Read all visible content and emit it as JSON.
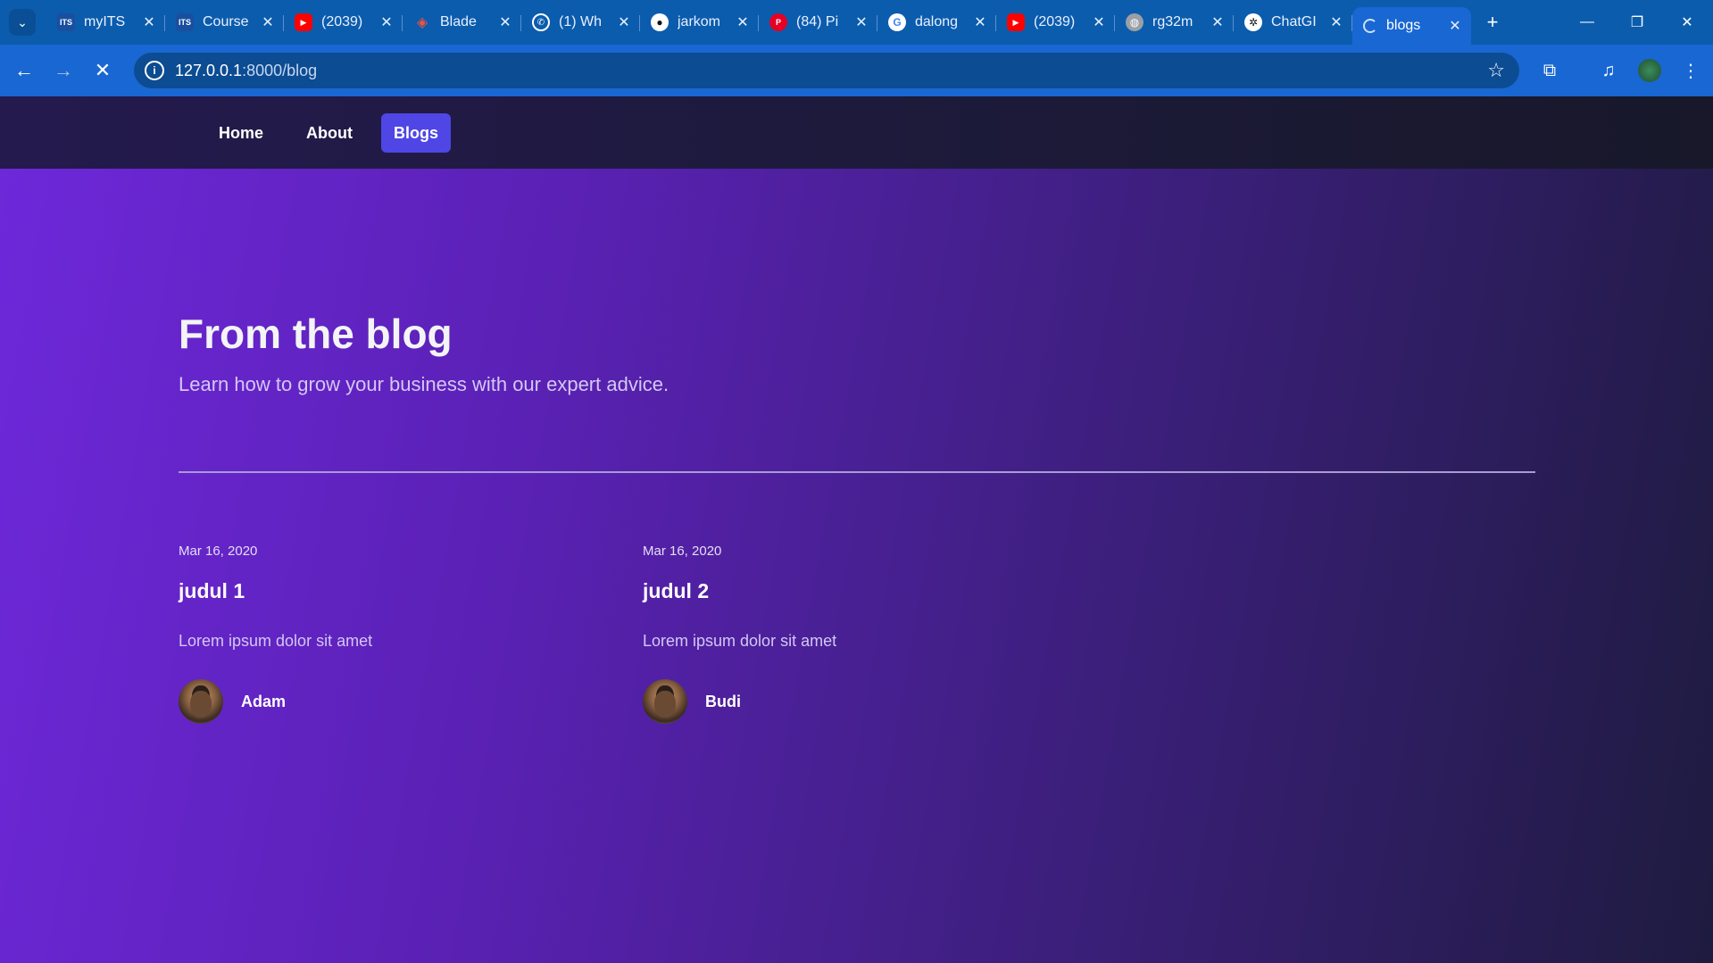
{
  "browser": {
    "tabs": [
      {
        "title": "myITS",
        "favicon": "its-logo",
        "color": "#1a4fa0"
      },
      {
        "title": "Course",
        "favicon": "its-logo",
        "color": "#1a4fa0"
      },
      {
        "title": "(2039)",
        "favicon": "youtube-icon",
        "color": "#ff0000"
      },
      {
        "title": "Blade",
        "favicon": "laravel-icon",
        "color": "#f05340"
      },
      {
        "title": "(1) Wh",
        "favicon": "whatsapp-icon",
        "color": "#25d366"
      },
      {
        "title": "jarkom",
        "favicon": "github-icon",
        "color": "#111111"
      },
      {
        "title": "(84) Pi",
        "favicon": "pinterest-icon",
        "color": "#e60023"
      },
      {
        "title": "dalong",
        "favicon": "google-icon",
        "color": "#ffffff"
      },
      {
        "title": "(2039)",
        "favicon": "youtube-icon",
        "color": "#ff0000"
      },
      {
        "title": "rg32m",
        "favicon": "globe-icon",
        "color": "#9aa0a6"
      },
      {
        "title": "ChatGI",
        "favicon": "chatgpt-icon",
        "color": "#ffffff"
      },
      {
        "title": "blogs",
        "favicon": "loading-icon",
        "color": "#1967d2",
        "active": true
      }
    ],
    "url_host": "127.0.0.1",
    "url_path": ":8000/blog"
  },
  "nav": {
    "links": [
      "Home",
      "About",
      "Blogs"
    ],
    "active": "Blogs"
  },
  "hero": {
    "title": "From the blog",
    "subtitle": "Learn how to grow your business with our expert advice."
  },
  "posts": [
    {
      "date": "Mar 16, 2020",
      "title": "judul 1",
      "excerpt": "Lorem ipsum dolor sit amet",
      "author": "Adam"
    },
    {
      "date": "Mar 16, 2020",
      "title": "judul 2",
      "excerpt": "Lorem ipsum dolor sit amet",
      "author": "Budi"
    }
  ],
  "colors": {
    "chrome": "#1967d2",
    "accent": "#4f46e5",
    "hero_start": "#6d28d9",
    "hero_end": "#1e1b3f"
  }
}
